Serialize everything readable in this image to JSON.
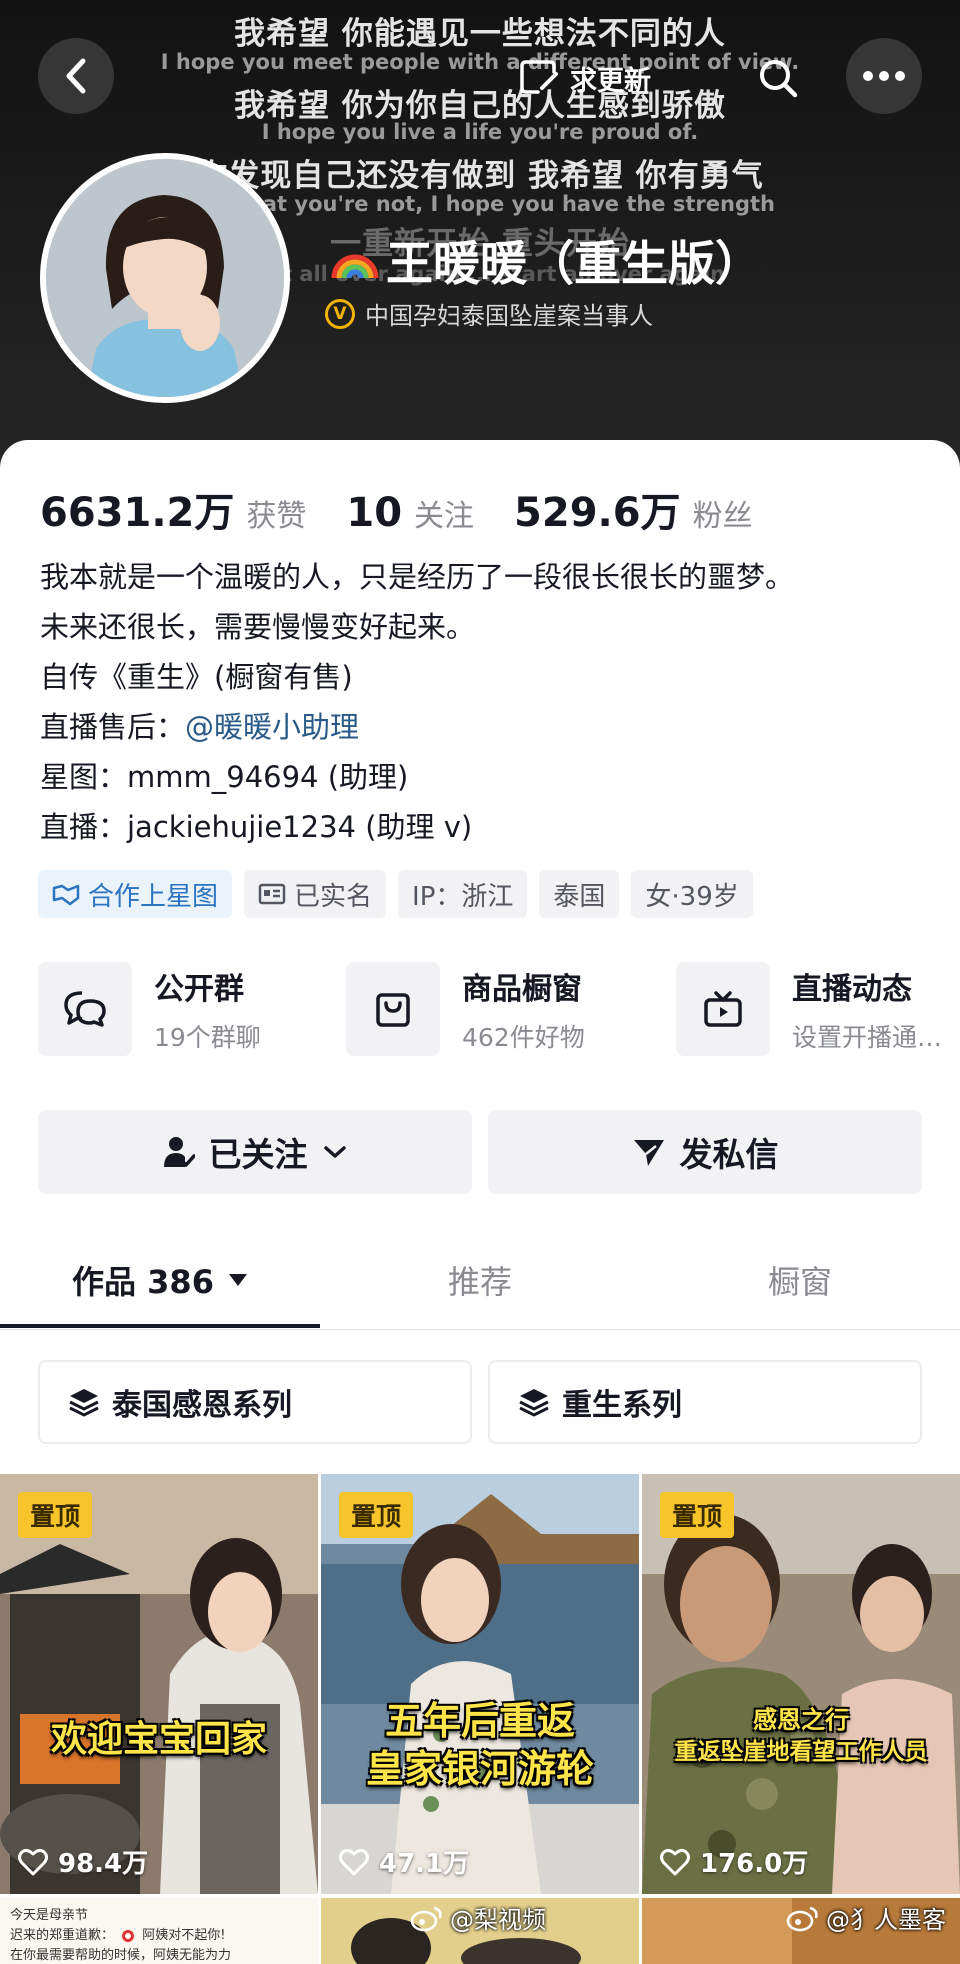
{
  "header": {
    "lyrics": [
      {
        "lang": "cn",
        "text": "我希望 你能遇见一些想法不同的人"
      },
      {
        "lang": "en",
        "text": "I hope you meet people with a different point of view."
      },
      {
        "lang": "cn",
        "text": "我希望 你为你自己的人生感到骄傲"
      },
      {
        "lang": "en",
        "text": "I hope you live a life you're proud of."
      },
      {
        "lang": "cn",
        "text": "你发现自己还没有做到 我希望 你有勇气"
      },
      {
        "lang": "en",
        "text": "find that you're not, I hope you have the strength"
      },
      {
        "lang": "cn",
        "text": "一重新开始 重头开始"
      },
      {
        "lang": "en",
        "text": "start all over again ... start all over again"
      }
    ],
    "update_label": "求更新",
    "name": "王暖暖（重生版）",
    "verified_badge": "V",
    "verified_text": "中国孕妇泰国坠崖案当事人"
  },
  "stats": [
    {
      "value": "6631.2万",
      "label": "获赞"
    },
    {
      "value": "10",
      "label": "关注"
    },
    {
      "value": "529.6万",
      "label": "粉丝"
    }
  ],
  "bio": {
    "line1": "我本就是一个温暖的人，只是经历了一段很长很长的噩梦。",
    "line2": "未来还很长，需要慢慢变好起来。",
    "line3": "自传《重生》(橱窗有售)",
    "line4_prefix": "直播售后：",
    "line4_link": "@暖暖小助理",
    "line5": "星图：mmm_94694 (助理)",
    "line6": "直播：jackiehujie1234 (助理 v)"
  },
  "tags": {
    "star": "合作上星图",
    "realname": "已实名",
    "ip": "IP：浙江",
    "country": "泰国",
    "gender_age": "女·39岁"
  },
  "services": [
    {
      "title": "公开群",
      "sub": "19个群聊",
      "icon": "chat-bubbles-icon"
    },
    {
      "title": "商品橱窗",
      "sub": "462件好物",
      "icon": "shopping-bag-icon"
    },
    {
      "title": "直播动态",
      "sub": "设置开播通…",
      "icon": "tv-icon"
    }
  ],
  "actions": {
    "follow": "已关注",
    "message": "发私信"
  },
  "tabs": {
    "works": "作品 386",
    "recommend": "推荐",
    "showcase": "橱窗"
  },
  "collections": {
    "c1": "泰国感恩系列",
    "c2": "重生系列"
  },
  "videos": [
    {
      "pin": "置顶",
      "caption": "欢迎宝宝回家",
      "likes": "98.4万"
    },
    {
      "pin": "置顶",
      "caption1": "五年后重返",
      "caption2": "皇家银河游轮",
      "likes": "47.1万"
    },
    {
      "pin": "置顶",
      "caption1": "感恩之行",
      "caption2": "重返坠崖地看望工作人员",
      "likes": "176.0万"
    }
  ],
  "row2": {
    "left_line1": "今天是母亲节",
    "left_line2": "迟来的郑重道歉：",
    "left_line2b": "阿姨对不起你!",
    "left_line3": "在你最需要帮助的时候，阿姨无能为力"
  },
  "watermarks": {
    "center": "@梨视频",
    "right": "@犭人墨客"
  },
  "colors": {
    "accent_blue": "#2b74c0",
    "pin_yellow": "#f7c529",
    "caption_yellow": "#ffe54a"
  }
}
